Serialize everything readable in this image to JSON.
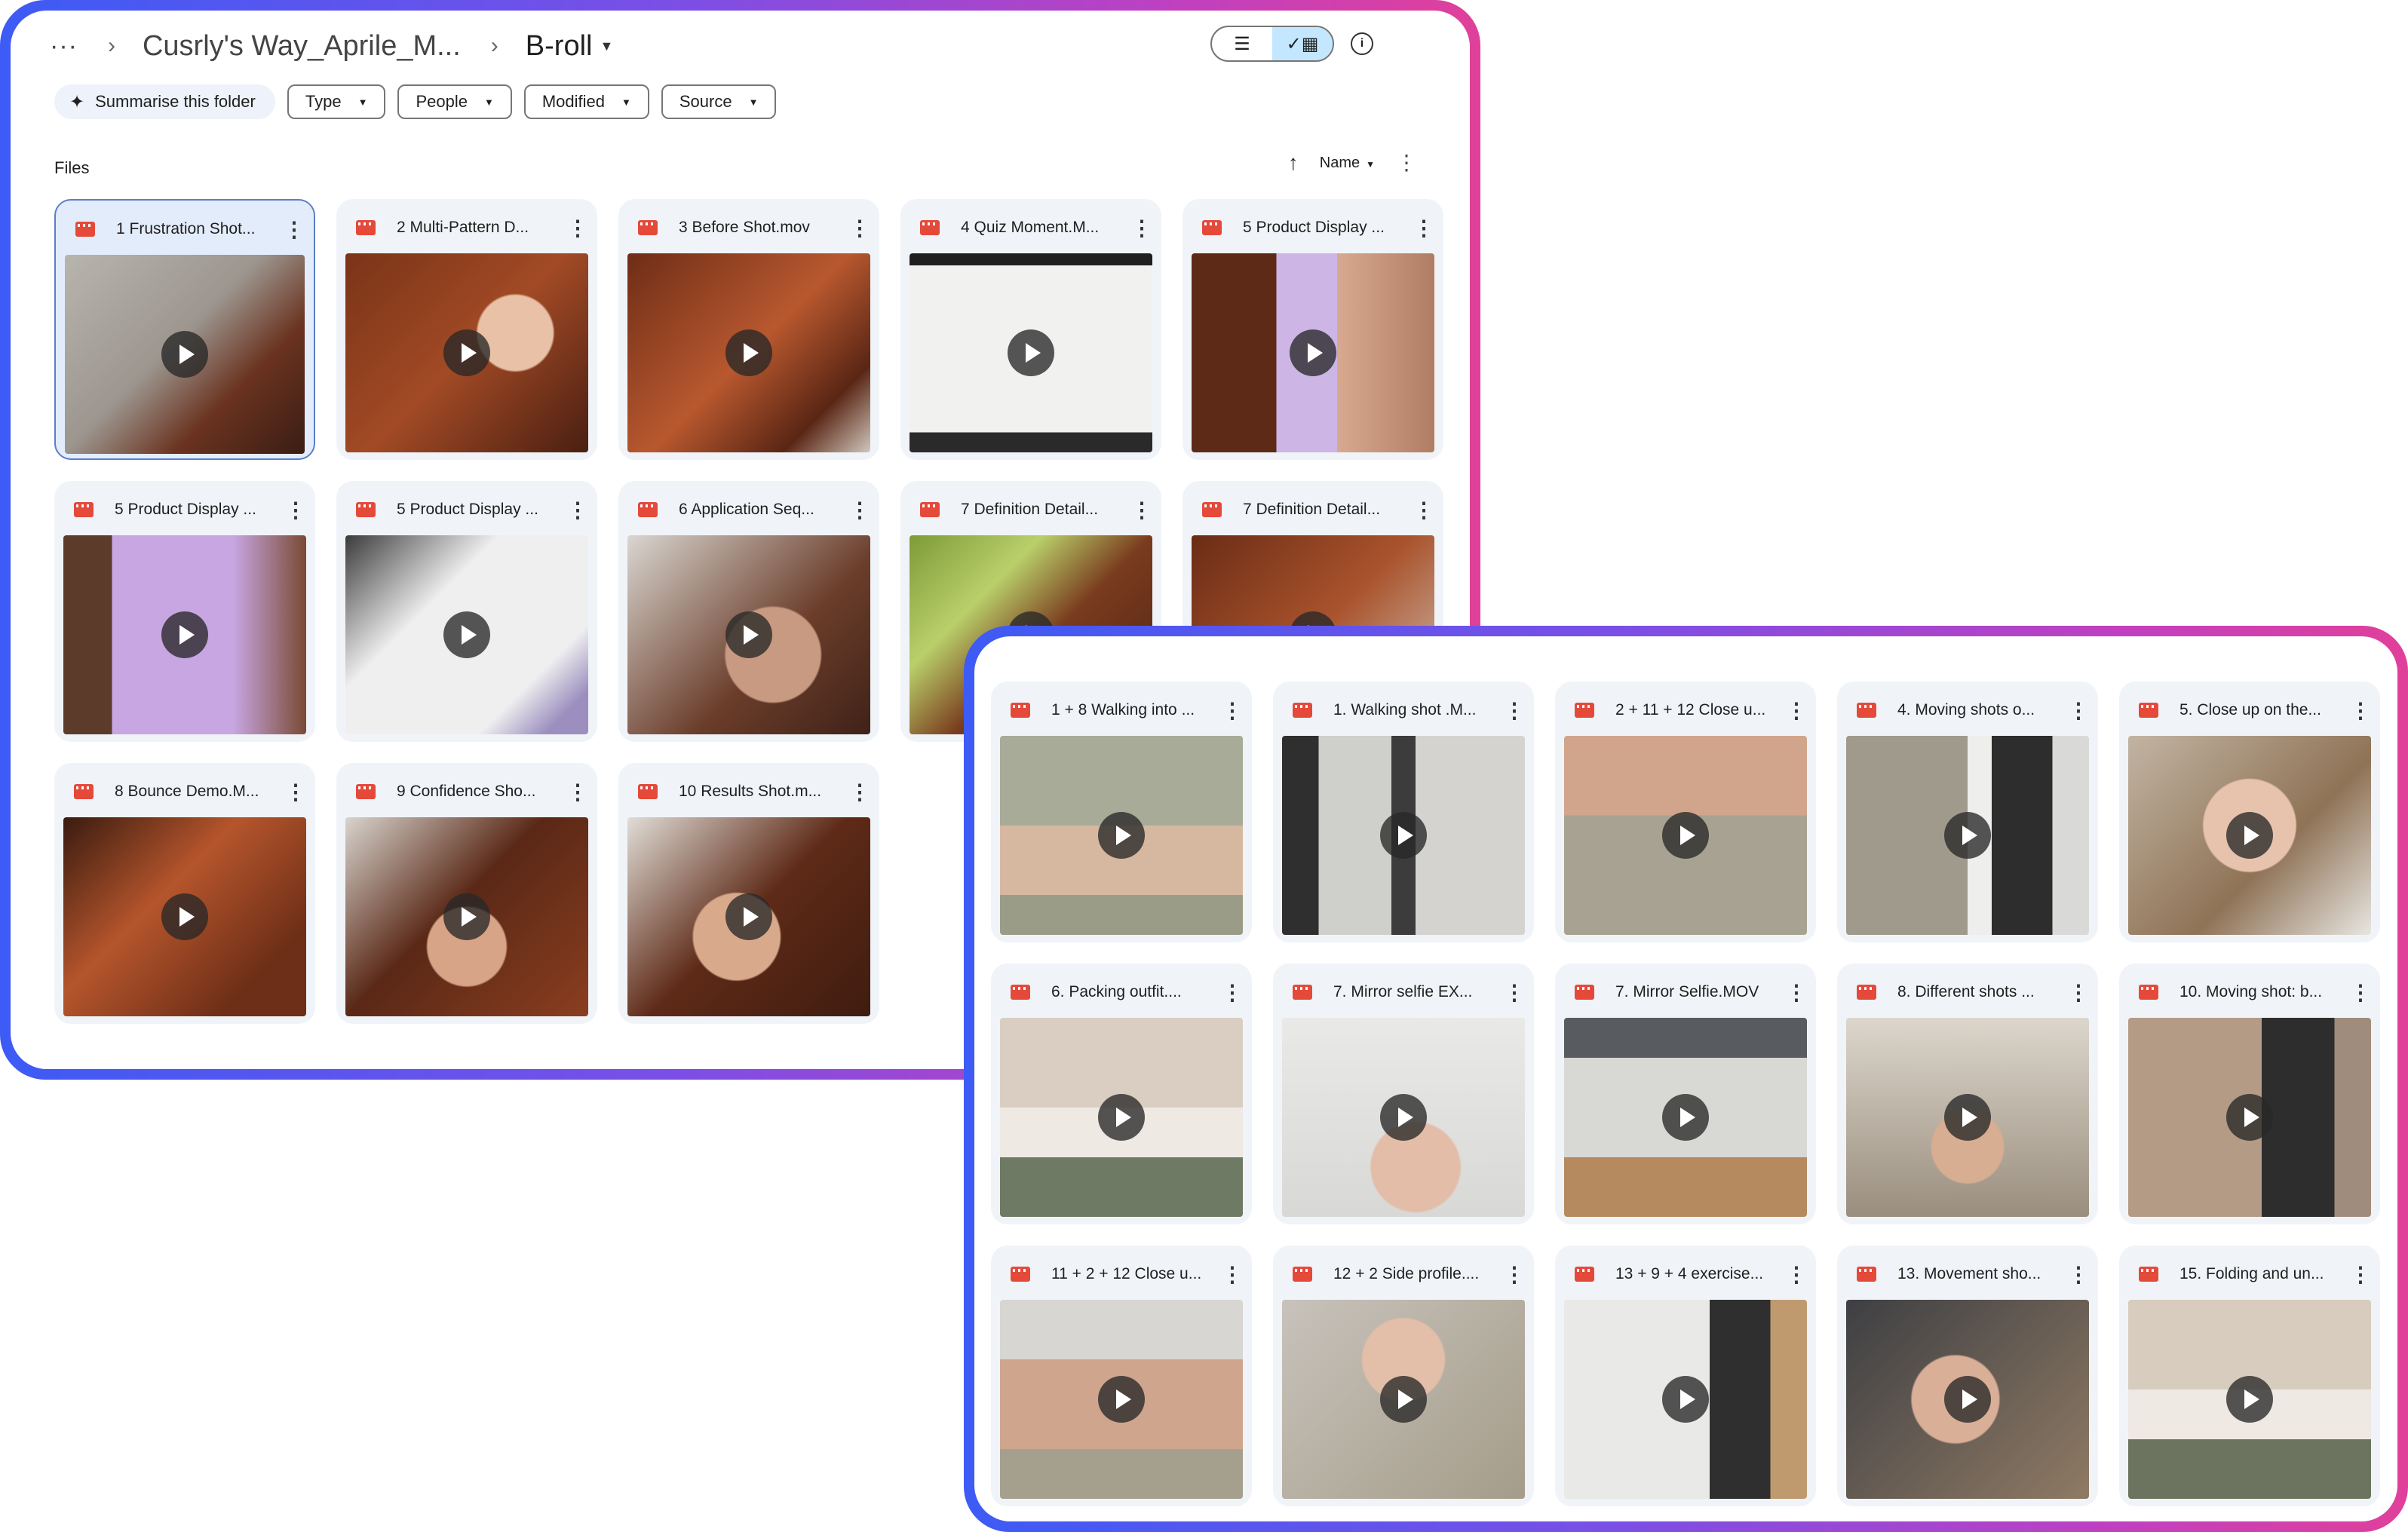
{
  "header": {
    "more": "···",
    "parent_folder": "Cusrly's Way_Aprile_M...",
    "current_folder": "B-roll"
  },
  "filters": {
    "summarise": "Summarise this folder",
    "type": "Type",
    "people": "People",
    "modified": "Modified",
    "source": "Source"
  },
  "section_label": "Files",
  "sort": {
    "label": "Name"
  },
  "colors": {
    "accent_selected": "#c2e7ff",
    "video_icon": "#e5493a",
    "gradient_start": "#3d5bf5",
    "gradient_end": "#e0409a"
  },
  "files_a": [
    {
      "name": "1 Frustration Shot...",
      "bg": "linear-gradient(135deg,#b8b4ae 0%,#9c968f 45%,#6b3320 70%,#3a1d14 100%)"
    },
    {
      "name": "2 Multi-Pattern D...",
      "bg": "radial-gradient(circle at 70% 40%,#e8c1a6 0 18%,transparent 19%),linear-gradient(135deg,#7a3418,#a24a25 50%,#4a1f12)"
    },
    {
      "name": "3 Before Shot.mov",
      "bg": "linear-gradient(135deg,#6e2d16,#b8582f 50%,#5a2614 80%,#cfc6bc)"
    },
    {
      "name": "4 Quiz Moment.M...",
      "bg": "linear-gradient(180deg,#1f1f1f 0 6%,#f1f1ef 6% 90%,#2a2a2a 90%)"
    },
    {
      "name": "5 Product Display ...",
      "bg": "linear-gradient(90deg,#5e2a18 0 35%,#cdb6e6 35% 60%,#d8a98f 60%,#b07d63)"
    },
    {
      "name": "5 Product Display ...",
      "bg": "linear-gradient(90deg,#5c3b2b 0 20%,#c7a6e2 20% 70%,#7a4a33)"
    },
    {
      "name": "5 Product Display ...",
      "bg": "linear-gradient(135deg,#3b3b3b,#efefef 35% 75%,#9c8fc0 90%)"
    },
    {
      "name": "6 Application Seq...",
      "bg": "radial-gradient(circle at 60% 60%,#c99a82 0 25%,transparent 26%),linear-gradient(135deg,#d9d6d1,#6b3d2a 60%,#3f2218)"
    },
    {
      "name": "7 Definition Detail...",
      "bg": "linear-gradient(135deg,#7d9b38,#b9cf6a 30%,#7a3b1e 55%,#4a2212)"
    },
    {
      "name": "7 Definition Detail...",
      "bg": "linear-gradient(135deg,#6a2c16,#a9532c 50%,#d4c9bd)"
    },
    {
      "name": "8 Bounce Demo.M...",
      "bg": "linear-gradient(135deg,#3a1b10,#b5552c 40%,#6d2f17 80%)"
    },
    {
      "name": "9 Confidence Sho...",
      "bg": "radial-gradient(circle at 50% 65%,#d7a488 0 22%,transparent 23%),linear-gradient(135deg,#d8d4ce,#5a2816 45%,#8a3e1f)"
    },
    {
      "name": "10 Results Shot.m...",
      "bg": "radial-gradient(circle at 45% 60%,#d9a98c 0 24%,transparent 25%),linear-gradient(135deg,#e1ddd7,#5e2a17 50%,#3f1c10)"
    }
  ],
  "files_b": [
    {
      "name": "1 + 8 Walking into ...",
      "bg": "linear-gradient(180deg,#a7ab97 0 45%,#d6b8a0 45% 80%,#9a9c88 80%)"
    },
    {
      "name": "1. Walking shot .M...",
      "bg": "linear-gradient(90deg,#2f2f2f 0 15%,#cfcfcb 15% 45%,#3c3c3c 45% 55%,#d5d3cf 55%)"
    },
    {
      "name": "2 + 11 + 12 Close u...",
      "bg": "linear-gradient(180deg,#d0a58b 0 40%,#a8a292 40%)"
    },
    {
      "name": "4. Moving shots o...",
      "bg": "linear-gradient(90deg,#9f9a8c 0 50%,#eeeeec 50% 60%,#2d2d2d 60% 85%,#d9d9d7 85%)"
    },
    {
      "name": "5. Close up on the...",
      "bg": "radial-gradient(circle at 50% 45%,#e7c3ad 0 28%,transparent 29%),linear-gradient(135deg,#c2b4a3,#8f7356 60%,#e7e5e1)"
    },
    {
      "name": "6. Packing outfit....",
      "bg": "linear-gradient(180deg,#d9cec1 0 45%,#efe9e3 45% 70%,#6f7a64 70%)"
    },
    {
      "name": "7. Mirror selfie EX...",
      "bg": "radial-gradient(circle at 55% 75%,#e3bda7 0 22%,transparent 23%),linear-gradient(180deg,#e9e9e7,#d8d8d6)"
    },
    {
      "name": "7. Mirror Selfie.MOV",
      "bg": "linear-gradient(180deg,#585c60 0 20%,#d8d8d5 20% 70%,#b58a5f 70%)"
    },
    {
      "name": "8. Different shots ...",
      "bg": "radial-gradient(circle at 50% 65%,#d8ae93 0 20%,transparent 21%),linear-gradient(180deg,#dcd6cc,#9a8e7e)"
    },
    {
      "name": "10. Moving shot: b...",
      "bg": "linear-gradient(90deg,#b49b86 0 55%,#2d2d2d 55% 85%,#a08c7c 85%)"
    },
    {
      "name": "11 + 2 + 12 Close u...",
      "bg": "linear-gradient(180deg,#d8d6d2 0 30%,#cfa58d 30% 75%,#a5a08e 75%)"
    },
    {
      "name": "12 + 2 Side profile....",
      "bg": "radial-gradient(circle at 50% 30%,#e3bea8 0 22%,transparent 23%),linear-gradient(135deg,#c7c2bb,#a59d8a)"
    },
    {
      "name": "13 + 9 + 4 exercise...",
      "bg": "linear-gradient(90deg,#e9e9e7 0 60%,#2f2f2f 60% 85%,#bf9a6f 85%)"
    },
    {
      "name": "13. Movement sho...",
      "bg": "radial-gradient(circle at 45% 50%,#d9af97 0 26%,transparent 27%),linear-gradient(135deg,#3e3f43,#8f7a64)"
    },
    {
      "name": "15. Folding and un...",
      "bg": "linear-gradient(180deg,#d8ccbe 0 45%,#efe9e3 45% 70%,#6c745f 70%)"
    }
  ]
}
